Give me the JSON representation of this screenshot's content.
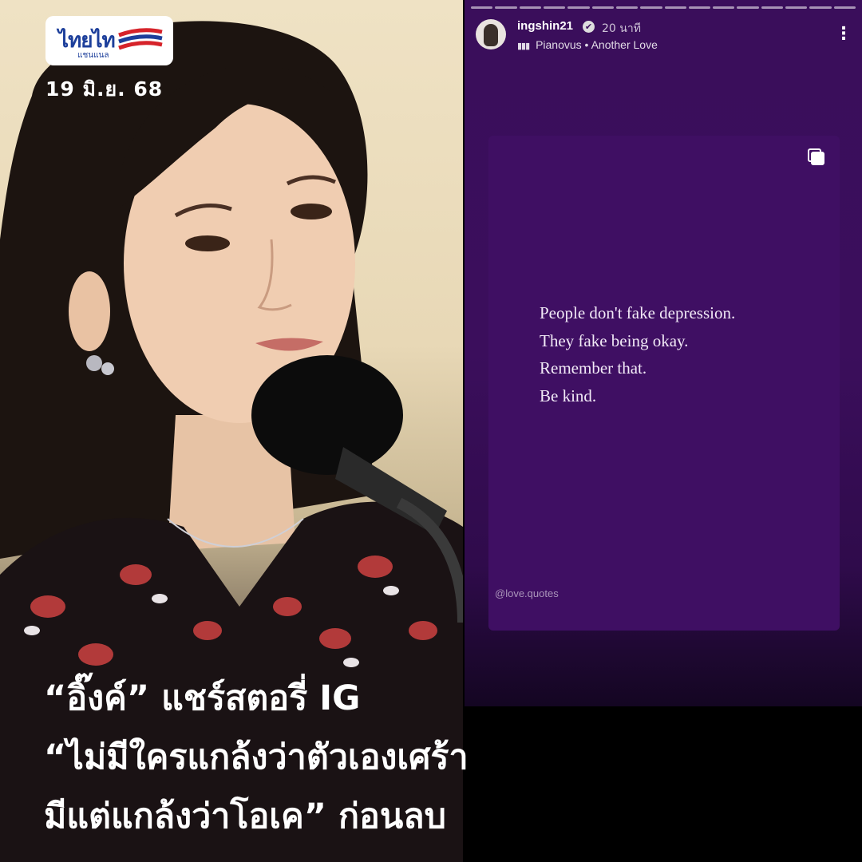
{
  "brand": {
    "logo_text": "ไทยไท",
    "logo_sub": "แชนแนล"
  },
  "post_date": "19 มิ.ย. 68",
  "story": {
    "username": "ingshin21",
    "time_ago": "20 นาที",
    "music_artist": "Pianovus",
    "music_separator": "•",
    "music_title": "Another Love",
    "more_menu": "⋮",
    "verified_glyph": "✔",
    "quote_lines": [
      "People don't fake depression.",
      "They fake being okay.",
      "Remember that.",
      "Be kind."
    ],
    "credit": "@love.quotes",
    "progress_segments": 16
  },
  "headline": {
    "line1": "“อิ๊งค์” แชร์สตอรี่ IG",
    "line2": "“ไม่มีใครแกล้งว่าตัวเองเศร้า",
    "line3": "มีแต่แกล้งว่าโอเค” ก่อนลบ"
  },
  "colors": {
    "story_bg": "#3b0e5c",
    "logo_blue": "#1d3f9b",
    "logo_red": "#d6232a"
  },
  "icons": {
    "verified": "verified-badge-icon",
    "music": "music-bars-icon",
    "more": "more-vertical-icon",
    "copy": "multi-post-icon"
  }
}
